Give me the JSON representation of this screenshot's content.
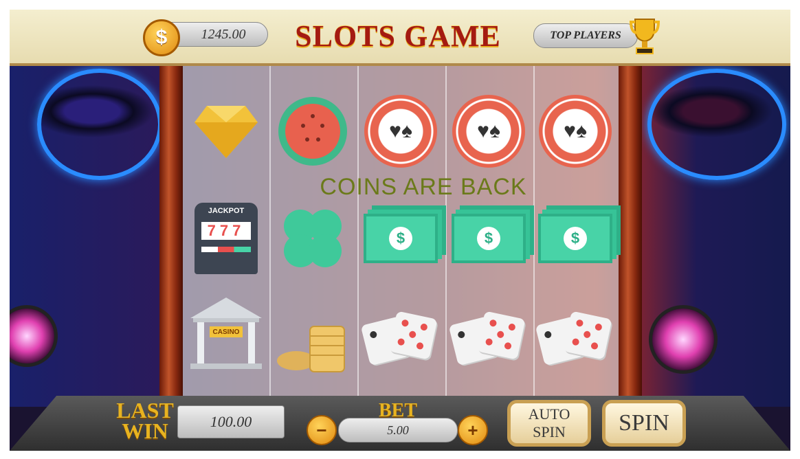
{
  "header": {
    "balance": "1245.00",
    "title": "SLOTS GAME",
    "top_players_label": "TOP PLAYERS"
  },
  "marquee": {
    "text": "COINS ARE BACK"
  },
  "reels": {
    "rows": [
      [
        "diamond",
        "watermelon",
        "poker-chip",
        "poker-chip",
        "poker-chip"
      ],
      [
        "jackpot-machine",
        "clover",
        "cash-stack",
        "cash-stack",
        "cash-stack"
      ],
      [
        "casino-building",
        "gold-coins",
        "dice",
        "dice",
        "dice"
      ]
    ],
    "jackpot_label": "JACKPOT",
    "jackpot_digits": "777",
    "casino_label": "CASINO"
  },
  "footer": {
    "last_win_label_1": "LAST",
    "last_win_label_2": "WIN",
    "last_win_value": "100.00",
    "bet_label": "BET",
    "bet_value": "5.00",
    "minus": "−",
    "plus": "+",
    "auto_spin_1": "AUTO",
    "auto_spin_2": "SPIN",
    "spin": "SPIN"
  },
  "colors": {
    "title_red": "#a41a12",
    "gold": "#e8b320",
    "chip_red": "#e8644e",
    "cash_green": "#48d3a7"
  }
}
